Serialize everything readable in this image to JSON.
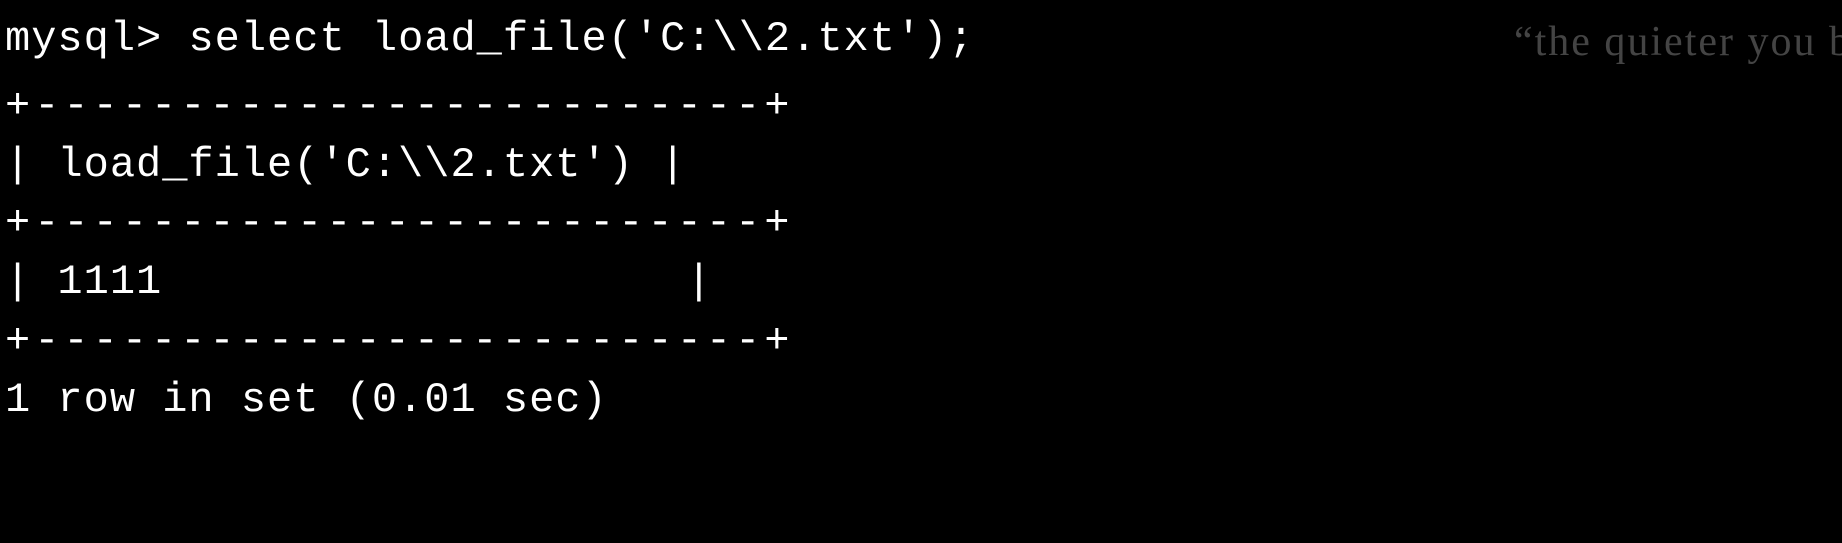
{
  "terminal": {
    "prompt": "mysql> ",
    "command": "select load_file('C:\\\\2.txt');",
    "table": {
      "border_top": "+-------------------------+",
      "header_row": "| load_file('C:\\\\2.txt') |",
      "border_mid": "+-------------------------+",
      "data_row": "| 1111                    |",
      "border_bottom": "+-------------------------+"
    },
    "status": "1 row in set (0.01 sec)"
  },
  "watermark": {
    "text": "“the quieter you b"
  }
}
